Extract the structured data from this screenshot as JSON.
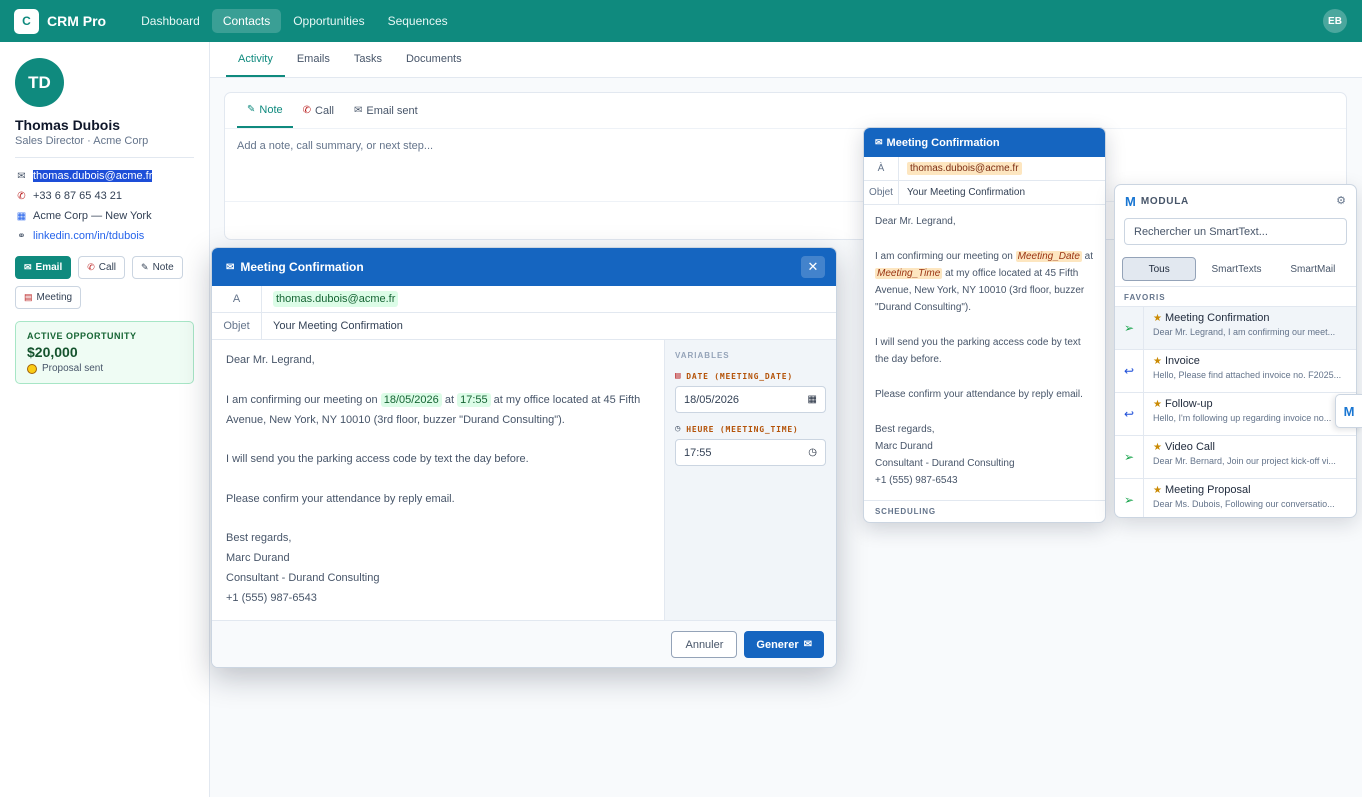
{
  "app": {
    "logo_letter": "C",
    "name": "CRM Pro",
    "user_initials": "EB"
  },
  "nav": [
    "Dashboard",
    "Contacts",
    "Opportunities",
    "Sequences"
  ],
  "contact": {
    "initials": "TD",
    "name": "Thomas Dubois",
    "role": "Sales Director · Acme Corp",
    "email": "thomas.dubois@acme.fr",
    "phone": "+33 6 87 65 43 21",
    "company": "Acme Corp — New York",
    "linkedin": "linkedin.com/in/tdubois",
    "actions": {
      "email": "Email",
      "call": "Call",
      "note": "Note",
      "meeting": "Meeting"
    },
    "opportunity": {
      "label": "ACTIVE OPPORTUNITY",
      "value": "$20,000",
      "status": "Proposal sent"
    }
  },
  "main_tabs": [
    "Activity",
    "Emails",
    "Tasks",
    "Documents"
  ],
  "activity": {
    "tabs": [
      "Note",
      "Call",
      "Email sent"
    ],
    "placeholder": "Add a note, call summary, or next step..."
  },
  "modal": {
    "title": "Meeting Confirmation",
    "to_label": "A",
    "to_value": "thomas.dubois@acme.fr",
    "subject_label": "Objet",
    "subject_value": "Your Meeting Confirmation",
    "body": {
      "greeting": "Dear Mr. Legrand,",
      "l1_a": "I am confirming our meeting on",
      "l1_date": "18/05/2026",
      "l1_at": "at",
      "l1_time": "17:55",
      "l1_b": "at my office located at 45 Fifth Avenue, New York, NY 10010 (3rd floor, buzzer \"Durand Consulting\").",
      "l2": "I will send you the parking access code by text the day before.",
      "l3": "Please confirm your attendance by reply email.",
      "sign1": "Best regards,",
      "sign2": "Marc Durand",
      "sign3": "Consultant - Durand Consulting",
      "sign4": "+1 (555) 987-6543"
    },
    "variables_title": "VARIABLES",
    "var_date_label": "DATE (MEETING_DATE)",
    "var_date_value": "18/05/2026",
    "var_time_label": "HEURE (MEETING_TIME)",
    "var_time_value": "17:55",
    "cancel": "Annuler",
    "generate": "Generer"
  },
  "preview": {
    "title": "Meeting Confirmation",
    "to_label": "À",
    "to_value": "thomas.dubois@acme.fr",
    "subject_label": "Objet",
    "subject_value": "Your Meeting Confirmation",
    "greeting": "Dear Mr. Legrand,",
    "l1_a": "I am confirming our meeting on",
    "var_date": "Meeting_Date",
    "l1_at": "at",
    "var_time": "Meeting_Time",
    "l1_b": "at my office located at 45 Fifth Avenue, New York, NY 10010 (3rd floor, buzzer \"Durand Consulting\").",
    "l2": "I will send you the parking access code by text the day before.",
    "l3": "Please confirm your attendance by reply email.",
    "sign1": "Best regards,",
    "sign2": "Marc Durand",
    "sign3": "Consultant - Durand Consulting",
    "sign4": "+1 (555) 987-6543",
    "scheduling": "SCHEDULING"
  },
  "modula": {
    "logo": "M",
    "title": "MODULA",
    "search_placeholder": "Rechercher un SmartText...",
    "segments": [
      "Tous",
      "SmartTexts",
      "SmartMail"
    ],
    "favorites_title": "FAVORIS",
    "favorites": [
      {
        "name": "Meeting Confirmation",
        "snippet": "Dear Mr. Legrand, I am confirming our meet...",
        "icon": "send-icon"
      },
      {
        "name": "Invoice",
        "snippet": "Hello, Please find attached invoice no. F2025...",
        "icon": "reply-icon"
      },
      {
        "name": "Follow-up",
        "snippet": "Hello, I'm following up regarding invoice no...",
        "icon": "reply-icon"
      },
      {
        "name": "Video Call",
        "snippet": "Dear Mr. Bernard, Join our project kick-off vi...",
        "icon": "send-icon"
      },
      {
        "name": "Meeting Proposal",
        "snippet": "Dear Ms. Dubois, Following our conversatio...",
        "icon": "send-icon"
      }
    ],
    "side_tab": "M"
  }
}
